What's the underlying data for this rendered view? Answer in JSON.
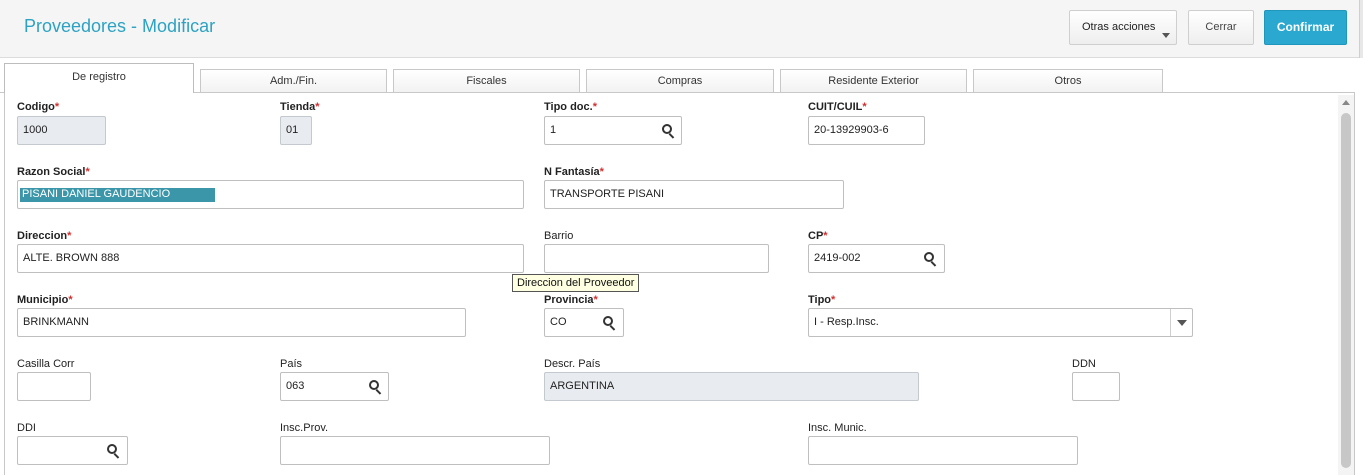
{
  "header": {
    "title": "Proveedores - Modificar",
    "otras_acciones": "Otras acciones",
    "cerrar": "Cerrar",
    "confirmar": "Confirmar"
  },
  "tabs": [
    {
      "label": "De registro"
    },
    {
      "label": "Adm./Fin."
    },
    {
      "label": "Fiscales"
    },
    {
      "label": "Compras"
    },
    {
      "label": "Residente Exterior"
    },
    {
      "label": "Otros"
    }
  ],
  "fields": {
    "codigo": {
      "label": "Codigo",
      "value": "1000"
    },
    "tienda": {
      "label": "Tienda",
      "value": "01"
    },
    "tipo_doc": {
      "label": "Tipo doc.",
      "value": "1"
    },
    "cuit": {
      "label": "CUIT/CUIL",
      "value": "20-13929903-6"
    },
    "razon_social": {
      "label": "Razon Social",
      "value": "PISANI  DANIEL  GAUDENCIO"
    },
    "n_fantasia": {
      "label": "N Fantasía",
      "value": "TRANSPORTE PISANI"
    },
    "direccion": {
      "label": "Direccion",
      "value": "ALTE. BROWN 888"
    },
    "barrio": {
      "label": "Barrio",
      "value": ""
    },
    "cp": {
      "label": "CP",
      "value": "2419-002"
    },
    "municipio": {
      "label": "Municipio",
      "value": "BRINKMANN"
    },
    "provincia": {
      "label": "Provincia",
      "value": "CO"
    },
    "tipo": {
      "label": "Tipo",
      "value": "I - Resp.Insc."
    },
    "casilla_corr": {
      "label": "Casilla Corr",
      "value": ""
    },
    "pais": {
      "label": "País",
      "value": "063"
    },
    "descr_pais": {
      "label": "Descr. País",
      "value": "ARGENTINA"
    },
    "ddn": {
      "label": "DDN",
      "value": ""
    },
    "ddi": {
      "label": "DDI",
      "value": ""
    },
    "insc_prov": {
      "label": "Insc.Prov.",
      "value": ""
    },
    "insc_munic": {
      "label": "Insc. Munic.",
      "value": ""
    }
  },
  "tooltip": "Direccion del Proveedor",
  "required_mark": "*",
  "colors": {
    "accent": "#2da2c2",
    "confirm": "#2aa8cf",
    "required": "#d32f2f",
    "selection": "#3a96a8"
  }
}
